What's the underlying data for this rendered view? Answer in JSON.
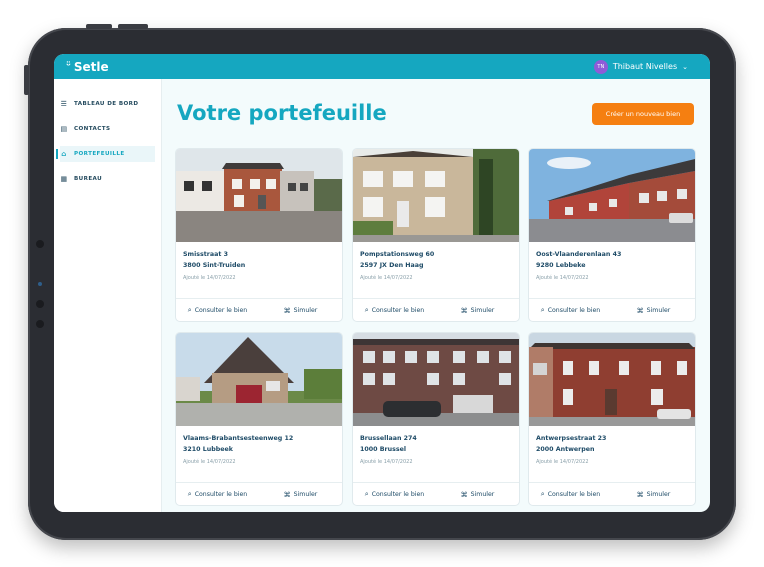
{
  "app": {
    "brand": "Setle",
    "logo_mark": "ᵕ̈"
  },
  "user": {
    "initials": "TN",
    "name": "Thibaut Nivelles"
  },
  "nav": [
    {
      "label": "TABLEAU DE BORD",
      "icon": "menu-icon"
    },
    {
      "label": "CONTACTS",
      "icon": "contacts-icon"
    },
    {
      "label": "PORTEFEUILLE",
      "icon": "home-icon",
      "active": true
    },
    {
      "label": "BUREAU",
      "icon": "office-icon"
    }
  ],
  "page": {
    "title": "Votre portefeuille",
    "cta": "Créer un nouveau bien"
  },
  "actions": {
    "view": "Consulter le bien",
    "simulate": "Simuler"
  },
  "properties": [
    {
      "street": "Smisstraat 3",
      "city": "3800 Sint-Truiden",
      "added": "Ajouté le 14/07/2022"
    },
    {
      "street": "Pompstationsweg 60",
      "city": "2597 JX Den Haag",
      "added": "Ajouté le 14/07/2022"
    },
    {
      "street": "Oost-Vlaanderenlaan 43",
      "city": "9280 Lebbeke",
      "added": "Ajouté le 14/07/2022"
    },
    {
      "street": "Vlaams-Brabantsesteenweg 12",
      "city": "3210 Lubbeek",
      "added": "Ajouté le 14/07/2022"
    },
    {
      "street": "Brussellaan 274",
      "city": "1000 Brussel",
      "added": "Ajouté le 14/07/2022"
    },
    {
      "street": "Antwerpsestraat 23",
      "city": "2000 Antwerpen",
      "added": "Ajouté le 14/07/2022"
    }
  ],
  "colors": {
    "primary": "#15a7c0",
    "accent": "#f57f11",
    "text": "#1d4a66"
  }
}
